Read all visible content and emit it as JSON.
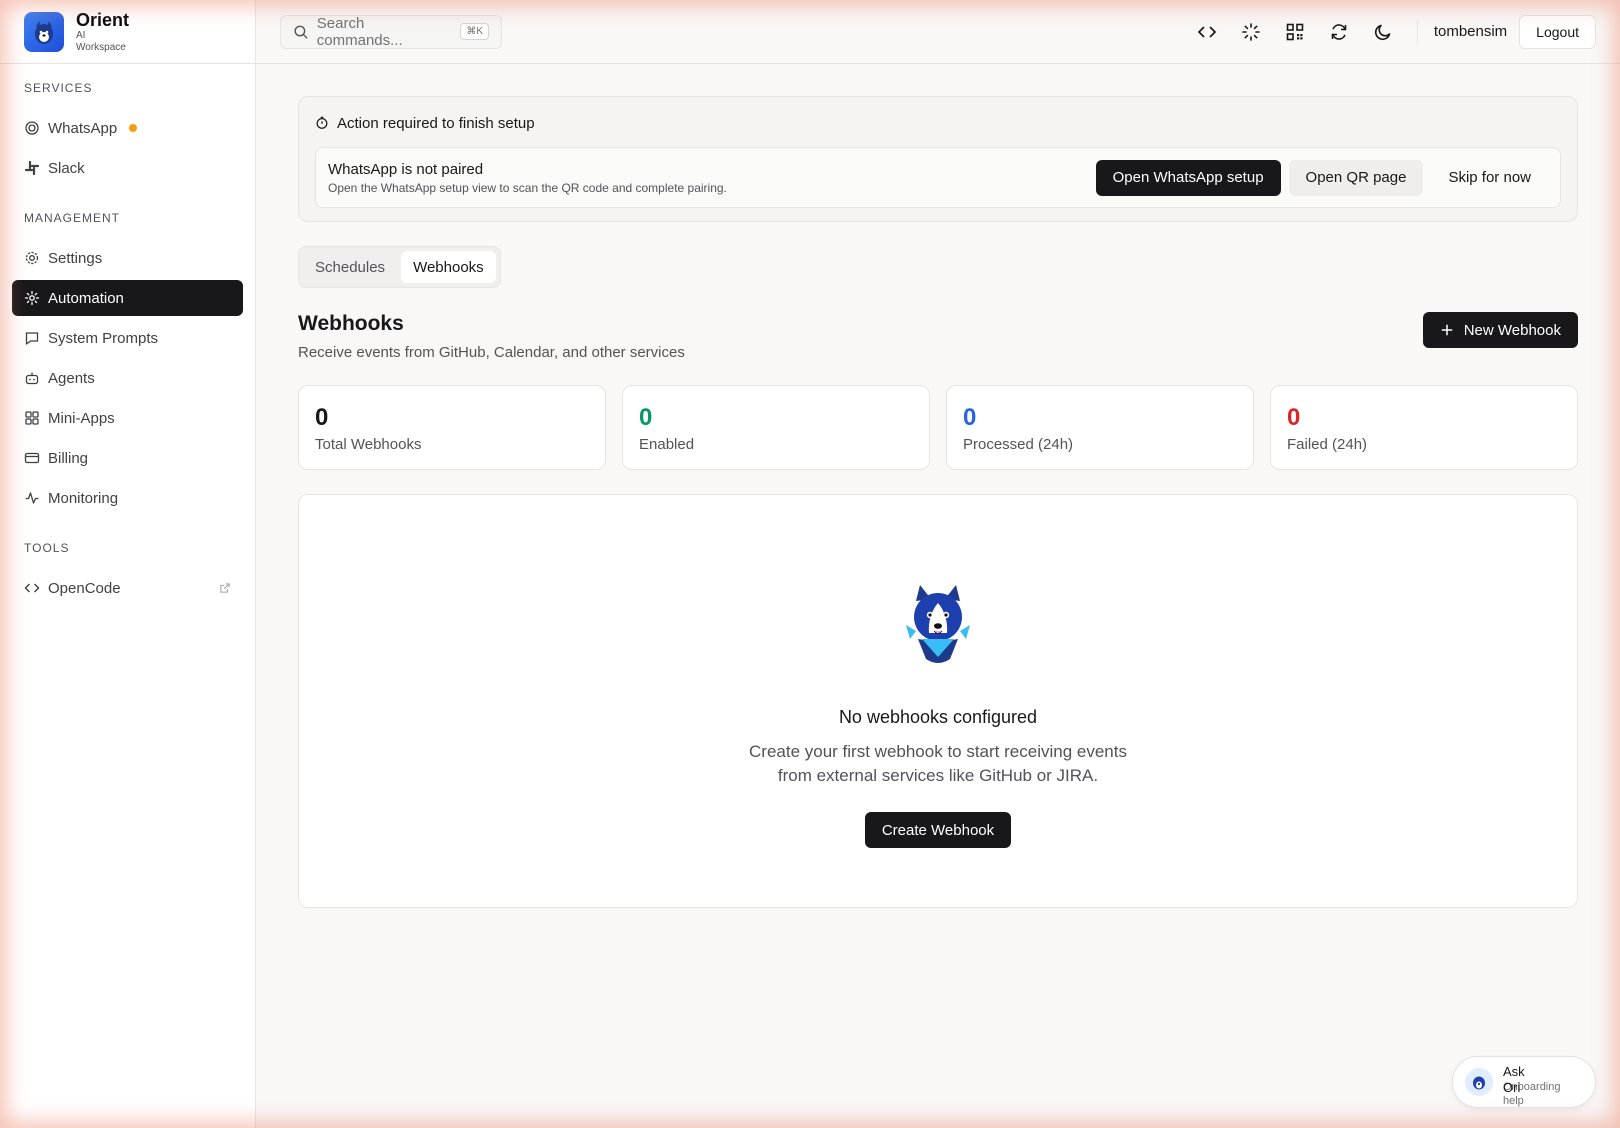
{
  "brand": {
    "name": "Orient",
    "subtitle": "AI Workspace"
  },
  "sidebar": {
    "sections": [
      {
        "heading": "SERVICES",
        "items": [
          {
            "label": "WhatsApp",
            "icon": "whatsapp-icon",
            "status": "pending"
          },
          {
            "label": "Slack",
            "icon": "slack-icon"
          }
        ]
      },
      {
        "heading": "MANAGEMENT",
        "items": [
          {
            "label": "Settings",
            "icon": "gear-icon"
          },
          {
            "label": "Automation",
            "icon": "automation-icon",
            "active": true
          },
          {
            "label": "System Prompts",
            "icon": "message-icon"
          },
          {
            "label": "Agents",
            "icon": "bot-icon"
          },
          {
            "label": "Mini-Apps",
            "icon": "grid-icon"
          },
          {
            "label": "Billing",
            "icon": "credit-card-icon"
          },
          {
            "label": "Monitoring",
            "icon": "activity-icon"
          }
        ]
      },
      {
        "heading": "TOOLS",
        "items": [
          {
            "label": "OpenCode",
            "icon": "code-icon",
            "external": true
          }
        ]
      }
    ]
  },
  "header": {
    "search_placeholder": "Search commands...",
    "search_shortcut": "⌘K",
    "icons": [
      "code-icon",
      "loader-icon",
      "qr-code-icon",
      "refresh-icon",
      "moon-icon"
    ],
    "username": "tombensim",
    "logout_label": "Logout"
  },
  "setup": {
    "title": "Action required to finish setup",
    "item_title": "WhatsApp is not paired",
    "item_desc": "Open the WhatsApp setup view to scan the QR code and complete pairing.",
    "primary_label": "Open WhatsApp setup",
    "secondary_label": "Open QR page",
    "skip_label": "Skip for now"
  },
  "tabs": [
    {
      "label": "Schedules",
      "active": false
    },
    {
      "label": "Webhooks",
      "active": true
    }
  ],
  "section": {
    "title": "Webhooks",
    "subtitle": "Receive events from GitHub, Calendar, and other services",
    "new_label": "New Webhook"
  },
  "stats": [
    {
      "value": "0",
      "label": "Total Webhooks",
      "color": "#18181b"
    },
    {
      "value": "0",
      "label": "Enabled",
      "color": "#059669"
    },
    {
      "value": "0",
      "label": "Processed (24h)",
      "color": "#2563eb"
    },
    {
      "value": "0",
      "label": "Failed (24h)",
      "color": "#dc2626"
    }
  ],
  "empty": {
    "title": "No webhooks configured",
    "description": "Create your first webhook to start receiving events from external services like GitHub or JIRA.",
    "cta_label": "Create Webhook"
  },
  "ask": {
    "title": "Ask Ori",
    "subtitle": "Onboarding help"
  },
  "colors": {
    "accent": "#18181b",
    "pending_dot": "#f59e0b",
    "brand_blue": "#2563eb"
  }
}
